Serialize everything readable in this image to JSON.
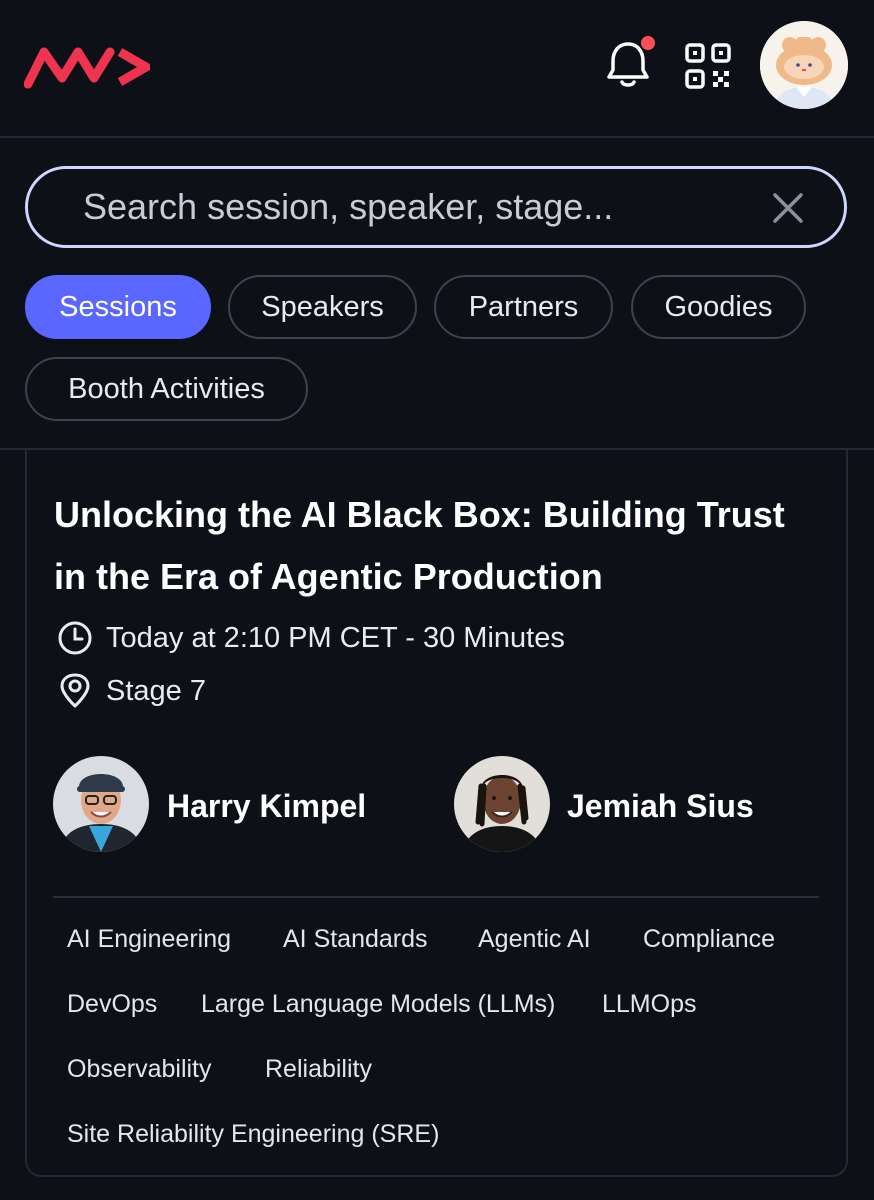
{
  "header": {
    "logo_icon": "wm-logo",
    "notification_icon": "bell-icon",
    "notification_badge_color": "#ff4d5a",
    "qr_icon": "qr-code-icon",
    "avatar_icon": "user-avatar"
  },
  "search": {
    "placeholder": "Search session, speaker, stage...",
    "value": "",
    "clear_icon": "close-icon"
  },
  "filters": [
    {
      "label": "Sessions",
      "active": true
    },
    {
      "label": "Speakers",
      "active": false
    },
    {
      "label": "Partners",
      "active": false
    },
    {
      "label": "Goodies",
      "active": false
    },
    {
      "label": "Booth Activities",
      "active": false
    }
  ],
  "session": {
    "title_line1": "Unlocking the AI Black Box: Building Trust",
    "title_line2": "in the Era of Agentic Production",
    "time": "Today at 2:10 PM CET - 30 Minutes",
    "stage": "Stage 7",
    "speakers": [
      {
        "name": "Harry Kimpel"
      },
      {
        "name": "Jemiah Sius"
      }
    ],
    "tags": [
      "AI Engineering",
      "AI Standards",
      "Agentic AI",
      "Compliance",
      "DevOps",
      "Large Language Models (LLMs)",
      "LLMOps",
      "Observability",
      "Reliability",
      "Site Reliability Engineering (SRE)"
    ]
  },
  "colors": {
    "background": "#0d1117",
    "accent": "#5a67ff",
    "brand": "#f0344f",
    "search_border": "#cfd6ff"
  }
}
